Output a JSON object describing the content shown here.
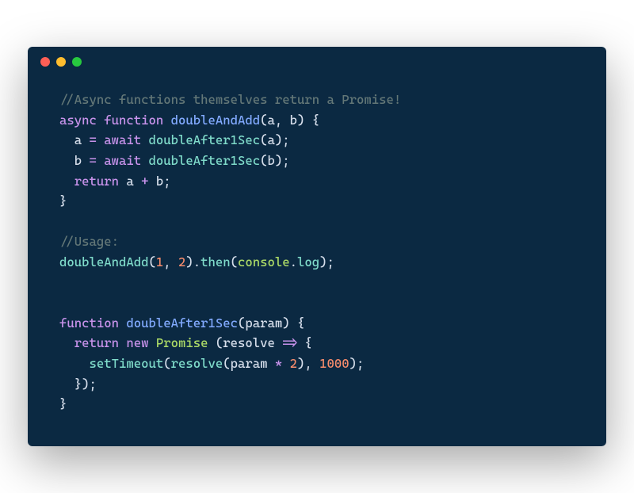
{
  "traffic_lights": {
    "red": "#ff5f56",
    "yellow": "#ffbd2e",
    "green": "#27c93f"
  },
  "tokens": [
    [
      [
        "c-comment",
        "//Async functions themselves return a Promise!"
      ]
    ],
    [
      [
        "c-keyword",
        "async"
      ],
      [
        "c-ident",
        " "
      ],
      [
        "c-keyword",
        "function"
      ],
      [
        "c-ident",
        " "
      ],
      [
        "c-func",
        "doubleAndAdd"
      ],
      [
        "c-punc",
        "("
      ],
      [
        "c-ident",
        "a"
      ],
      [
        "c-punc",
        ", "
      ],
      [
        "c-ident",
        "b"
      ],
      [
        "c-punc",
        ") {"
      ]
    ],
    [
      [
        "c-ident",
        "  a "
      ],
      [
        "c-op",
        "="
      ],
      [
        "c-ident",
        " "
      ],
      [
        "c-keyword",
        "await"
      ],
      [
        "c-ident",
        " "
      ],
      [
        "c-call",
        "doubleAfter1Sec"
      ],
      [
        "c-punc",
        "("
      ],
      [
        "c-ident",
        "a"
      ],
      [
        "c-punc",
        ");"
      ]
    ],
    [
      [
        "c-ident",
        "  b "
      ],
      [
        "c-op",
        "="
      ],
      [
        "c-ident",
        " "
      ],
      [
        "c-keyword",
        "await"
      ],
      [
        "c-ident",
        " "
      ],
      [
        "c-call",
        "doubleAfter1Sec"
      ],
      [
        "c-punc",
        "("
      ],
      [
        "c-ident",
        "b"
      ],
      [
        "c-punc",
        ");"
      ]
    ],
    [
      [
        "c-ident",
        "  "
      ],
      [
        "c-keyword",
        "return"
      ],
      [
        "c-ident",
        " a "
      ],
      [
        "c-op",
        "+"
      ],
      [
        "c-ident",
        " b"
      ],
      [
        "c-punc",
        ";"
      ]
    ],
    [
      [
        "c-punc",
        "}"
      ]
    ],
    [
      [
        "c-ident",
        ""
      ]
    ],
    [
      [
        "c-comment",
        "//Usage:"
      ]
    ],
    [
      [
        "c-call",
        "doubleAndAdd"
      ],
      [
        "c-punc",
        "("
      ],
      [
        "c-num",
        "1"
      ],
      [
        "c-punc",
        ", "
      ],
      [
        "c-num",
        "2"
      ],
      [
        "c-punc",
        "))."
      ],
      [
        "c-call",
        "then"
      ],
      [
        "c-punc",
        "("
      ],
      [
        "c-const",
        "console"
      ],
      [
        "c-punc",
        "."
      ],
      [
        "c-call",
        "log"
      ],
      [
        "c-punc",
        ");"
      ]
    ],
    [
      [
        "c-ident",
        ""
      ]
    ],
    [
      [
        "c-ident",
        ""
      ]
    ],
    [
      [
        "c-keyword",
        "function"
      ],
      [
        "c-ident",
        " "
      ],
      [
        "c-func",
        "doubleAfter1Sec"
      ],
      [
        "c-punc",
        "("
      ],
      [
        "c-ident",
        "param"
      ],
      [
        "c-punc",
        ") {"
      ]
    ],
    [
      [
        "c-ident",
        "  "
      ],
      [
        "c-keyword",
        "return"
      ],
      [
        "c-ident",
        " "
      ],
      [
        "c-keyword",
        "new"
      ],
      [
        "c-ident",
        " "
      ],
      [
        "c-const",
        "Promise"
      ],
      [
        "c-ident",
        " "
      ],
      [
        "c-punc",
        "("
      ],
      [
        "c-ident",
        "resolve "
      ],
      [
        "c-op",
        "=>"
      ],
      [
        "c-punc",
        " {"
      ]
    ],
    [
      [
        "c-ident",
        "    "
      ],
      [
        "c-call",
        "setTimeout"
      ],
      [
        "c-punc",
        "("
      ],
      [
        "c-call",
        "resolve"
      ],
      [
        "c-punc",
        "("
      ],
      [
        "c-ident",
        "param "
      ],
      [
        "c-op",
        "*"
      ],
      [
        "c-ident",
        " "
      ],
      [
        "c-num",
        "2"
      ],
      [
        "c-punc",
        "), "
      ],
      [
        "c-num",
        "1000"
      ],
      [
        "c-punc",
        ");"
      ]
    ],
    [
      [
        "c-ident",
        "  "
      ],
      [
        "c-punc",
        "});"
      ]
    ],
    [
      [
        "c-punc",
        "}"
      ]
    ]
  ],
  "fix_line9": [
    [
      "c-call",
      "doubleAndAdd"
    ],
    [
      "c-punc",
      "("
    ],
    [
      "c-num",
      "1"
    ],
    [
      "c-punc",
      ", "
    ],
    [
      "c-num",
      "2"
    ],
    [
      "c-punc",
      ")."
    ],
    [
      "c-call",
      "then"
    ],
    [
      "c-punc",
      "("
    ],
    [
      "c-const",
      "console"
    ],
    [
      "c-punc",
      "."
    ],
    [
      "c-call",
      "log"
    ],
    [
      "c-punc",
      ");"
    ]
  ]
}
